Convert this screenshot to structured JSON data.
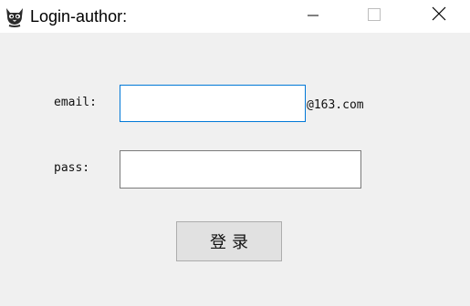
{
  "window": {
    "title": "Login-author:",
    "app_icon": "cat-icon",
    "controls": {
      "minimize_icon": "minimize-icon",
      "maximize_icon": "maximize-icon",
      "close_icon": "close-icon"
    }
  },
  "form": {
    "email_label": "email:",
    "email_value": "",
    "email_suffix": "@163.com",
    "pass_label": "pass:",
    "pass_value": "",
    "login_button": "登录"
  },
  "colors": {
    "background": "#f0f0f0",
    "titlebar": "#ffffff",
    "focus_border": "#0078d7",
    "button_bg": "#e1e1e1"
  }
}
